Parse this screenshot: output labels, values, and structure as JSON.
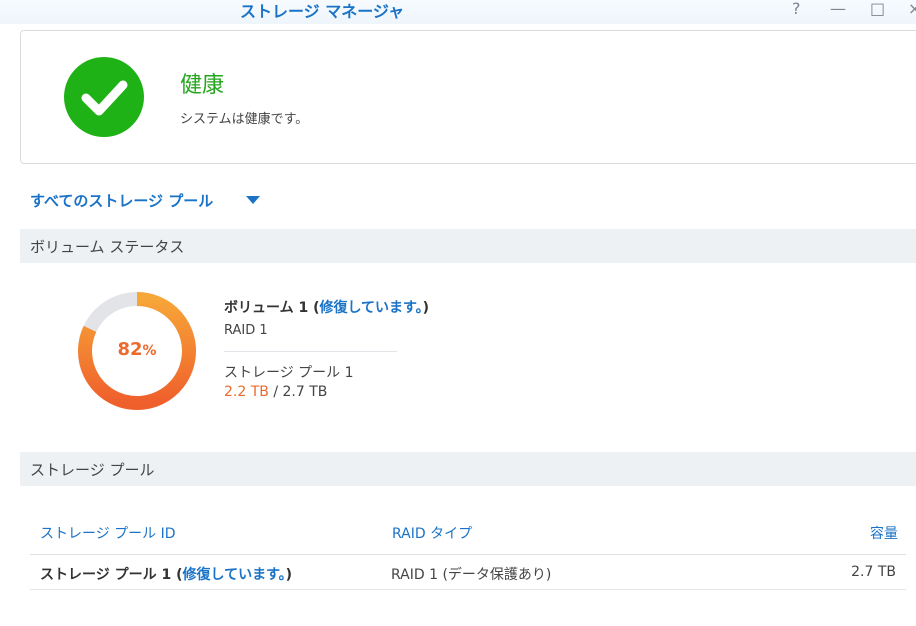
{
  "window": {
    "title": "ストレージ マネージャ",
    "help_icon": "?",
    "minimize_icon": "—",
    "maximize_icon": "□",
    "close_icon": "×"
  },
  "health": {
    "title": "健康",
    "description": "システムは健康です。",
    "icon": "checkmark-icon",
    "color": "#1fb217"
  },
  "pool_selector": {
    "label": "すべてのストレージ プール"
  },
  "volume_status": {
    "section_label": "ボリューム ステータス",
    "volume_name": "ボリューム 1 (",
    "volume_state": "修復しています。",
    "volume_close": ")",
    "raid_level": "RAID 1",
    "storage_pool": "ストレージ プール 1",
    "used": "2.2 TB",
    "separator": " / ",
    "total": "2.7 TB",
    "usage_percent_number": "82",
    "usage_percent_sign": "%",
    "usage_fraction": 0.82,
    "colors": {
      "gauge_start": "#f7a638",
      "gauge_end": "#ef5f2c",
      "track": "#e2e4e7"
    }
  },
  "storage_pool": {
    "section_label": "ストレージ プール",
    "columns": {
      "id": "ストレージ プール ID",
      "raid_type": "RAID タイプ",
      "capacity": "容量"
    },
    "rows": [
      {
        "name": "ストレージ プール 1 (",
        "state": "修復しています。",
        "close": ")",
        "raid_type": "RAID 1 (データ保護あり)",
        "capacity": "2.7 TB"
      }
    ]
  },
  "accent_color": "#1a73c7"
}
